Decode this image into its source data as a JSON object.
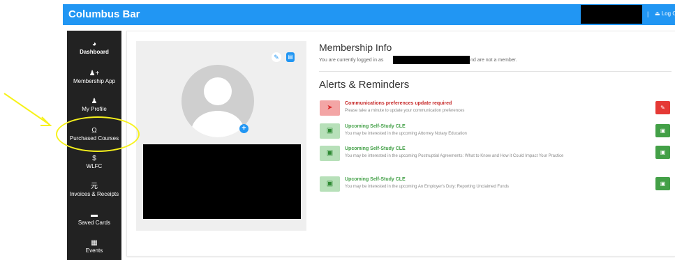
{
  "header": {
    "title": "Columbus Bar",
    "separator": "|",
    "logout_icon": "sign-out-icon",
    "logout_label": "⏏ Log Ou"
  },
  "sidebar": {
    "items": [
      {
        "icon": "◕",
        "icon_name": "dashboard-icon",
        "label": "Dashboard"
      },
      {
        "icon": "♟+",
        "icon_name": "user-plus-icon",
        "label": "Membership App"
      },
      {
        "icon": "♟",
        "icon_name": "user-icon",
        "label": "My Profile"
      },
      {
        "icon": "Ω",
        "icon_name": "graduation-icon",
        "label": "Purchased Courses"
      },
      {
        "icon": "$",
        "icon_name": "dollar-icon",
        "label": "WLFC"
      },
      {
        "icon": "元",
        "icon_name": "bank-icon",
        "label": "Invoices & Receipts"
      },
      {
        "icon": "▬",
        "icon_name": "credit-card-icon",
        "label": "Saved Cards"
      },
      {
        "icon": "▦",
        "icon_name": "calendar-icon",
        "label": "Events"
      }
    ]
  },
  "profile": {
    "edit_icon": "✎",
    "card_icon": "▤",
    "add_photo_icon": "+"
  },
  "membership": {
    "heading": "Membership Info",
    "info_prefix": "You are currently logged in as",
    "info_suffix": "nd are not a member."
  },
  "alerts": {
    "heading": "Alerts & Reminders",
    "items": [
      {
        "type": "red",
        "icon": "➤",
        "icon_name": "paper-plane-icon",
        "title": "Communications preferences update required",
        "desc": "Please take a minute to update your communication preferences",
        "btn_icon": "✎",
        "btn_icon_name": "edit-icon"
      },
      {
        "type": "green",
        "icon": "▣",
        "icon_name": "calendar-icon",
        "title": "Upcoming Self-Study CLE",
        "desc": "You may be interested in the upcoming Attorney Notary Education",
        "btn_icon": "▣",
        "btn_icon_name": "external-link-icon"
      },
      {
        "type": "green",
        "icon": "▣",
        "icon_name": "calendar-icon",
        "title": "Upcoming Self-Study CLE",
        "desc": "You may be interested in the upcoming Postnuptial Agreements: What to Know and How it Could Impact Your Practice",
        "btn_icon": "▣",
        "btn_icon_name": "external-link-icon"
      },
      {
        "type": "green",
        "icon": "▣",
        "icon_name": "calendar-icon",
        "title": "Upcoming Self-Study CLE",
        "desc": "You may be interested in the upcoming An Employer's Duty: Reporting Unclaimed Funds",
        "btn_icon": "▣",
        "btn_icon_name": "external-link-icon"
      }
    ]
  },
  "colors": {
    "header": "#2196f3",
    "sidebar": "#222222",
    "alert_red": "#e53935",
    "alert_green": "#43a047",
    "annotation": "#f7f21c"
  }
}
